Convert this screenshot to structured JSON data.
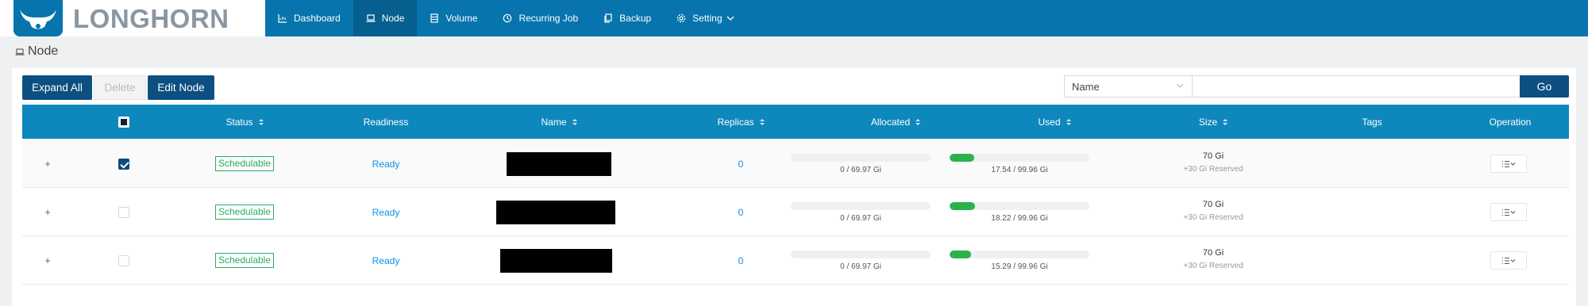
{
  "app": {
    "logo_text": "LONGHORN"
  },
  "nav": [
    {
      "label": "Dashboard",
      "icon": "dashboard-icon"
    },
    {
      "label": "Node",
      "icon": "laptop-icon",
      "active": true
    },
    {
      "label": "Volume",
      "icon": "database-icon"
    },
    {
      "label": "Recurring Job",
      "icon": "history-icon"
    },
    {
      "label": "Backup",
      "icon": "copy-icon"
    },
    {
      "label": "Setting",
      "icon": "gear-icon"
    }
  ],
  "page": {
    "title": "Node"
  },
  "toolbar": {
    "expand_all": "Expand All",
    "delete": "Delete",
    "edit_node": "Edit Node",
    "filter_field": "Name",
    "search_value": "",
    "go": "Go"
  },
  "table": {
    "columns": [
      "Status",
      "Readiness",
      "Name",
      "Replicas",
      "Allocated",
      "Used",
      "Size",
      "Tags",
      "Operation"
    ],
    "rows": [
      {
        "expand": "+",
        "checked": true,
        "status": "Schedulable",
        "readiness": "Ready",
        "name": "[redacted]",
        "replicas": "0",
        "allocated_label": "0 / 69.97 Gi",
        "allocated_pct": 0,
        "used_label": "17.54 / 99.96 Gi",
        "used_pct": 17.5,
        "size": "70 Gi",
        "reserved": "+30 Gi Reserved",
        "tags": ""
      },
      {
        "expand": "+",
        "checked": false,
        "status": "Schedulable",
        "readiness": "Ready",
        "name": "[redacted]",
        "replicas": "0",
        "allocated_label": "0 / 69.97 Gi",
        "allocated_pct": 0,
        "used_label": "18.22 / 99.96 Gi",
        "used_pct": 18.2,
        "size": "70 Gi",
        "reserved": "+30 Gi Reserved",
        "tags": ""
      },
      {
        "expand": "+",
        "checked": false,
        "status": "Schedulable",
        "readiness": "Ready",
        "name": "[redacted]",
        "replicas": "0",
        "allocated_label": "0 / 69.97 Gi",
        "allocated_pct": 0,
        "used_label": "15.29 / 99.96 Gi",
        "used_pct": 15.3,
        "size": "70 Gi",
        "reserved": "+30 Gi Reserved",
        "tags": ""
      }
    ]
  },
  "colors": {
    "header": "#0774ad",
    "table_header": "#0e87bd",
    "primary_button": "#0c4f80",
    "success": "#27ae60",
    "link": "#108ee9"
  }
}
